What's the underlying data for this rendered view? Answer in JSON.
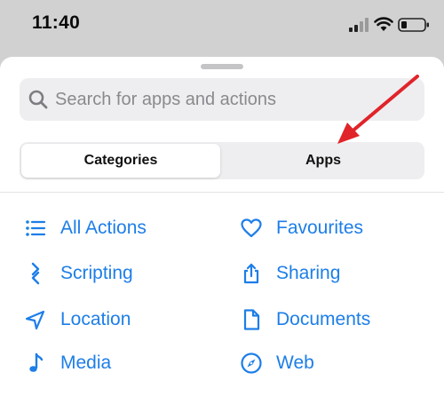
{
  "status_bar": {
    "time": "11:40",
    "signal_icon": "cellular-signal-icon",
    "wifi_icon": "wifi-icon",
    "battery_icon": "battery-low-icon"
  },
  "search": {
    "placeholder": "Search for apps and actions",
    "icon": "search-icon"
  },
  "segments": {
    "categories_label": "Categories",
    "apps_label": "Apps",
    "selected": "Categories"
  },
  "categories": [
    {
      "label": "All Actions",
      "icon": "list-icon"
    },
    {
      "label": "Favourites",
      "icon": "heart-icon"
    },
    {
      "label": "Scripting",
      "icon": "scripting-icon"
    },
    {
      "label": "Sharing",
      "icon": "share-icon"
    },
    {
      "label": "Location",
      "icon": "location-arrow-icon"
    },
    {
      "label": "Documents",
      "icon": "document-icon"
    },
    {
      "label": "Media",
      "icon": "music-note-icon"
    },
    {
      "label": "Web",
      "icon": "compass-icon"
    }
  ],
  "colors": {
    "accent": "#1d7ee8",
    "annotation_arrow": "#e0242a",
    "dimmed_background": "#d1d1d1"
  }
}
